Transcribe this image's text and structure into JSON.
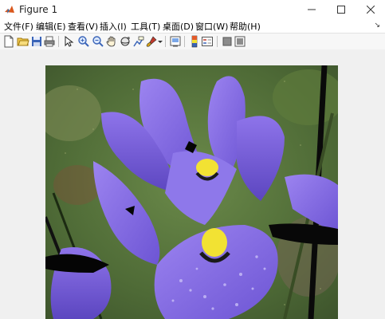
{
  "window": {
    "title": "Figure 1"
  },
  "menu": {
    "items": [
      {
        "label": "文件(F)"
      },
      {
        "label": "编辑(E)"
      },
      {
        "label": "查看(V)"
      },
      {
        "label": "插入(I)"
      },
      {
        "label": "工具(T)"
      },
      {
        "label": "桌面(D)"
      },
      {
        "label": "窗口(W)"
      },
      {
        "label": "帮助(H)"
      }
    ]
  },
  "toolbar": {
    "icons": [
      "new-figure-icon",
      "open-file-icon",
      "save-icon",
      "print-icon",
      "edit-plot-arrow-icon",
      "zoom-in-icon",
      "zoom-out-icon",
      "pan-hand-icon",
      "rotate-3d-icon",
      "data-cursor-icon",
      "brush-icon",
      "link-plot-icon",
      "insert-colorbar-icon",
      "insert-legend-icon",
      "hide-plot-tools-icon",
      "show-plot-tools-icon"
    ]
  },
  "figure": {
    "image": "purple-iris-flower-photo"
  },
  "colors": {
    "titlebar": "#ffffff",
    "menubar": "#ffffff",
    "toolbar": "#f7f7f7",
    "canvas": "#f0f0f0",
    "iris": "#8a6fe0",
    "iris_center": "#f2e233"
  }
}
